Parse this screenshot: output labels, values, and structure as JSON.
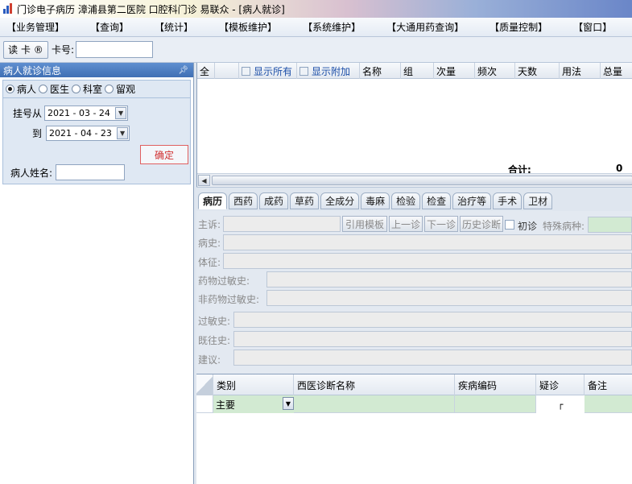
{
  "window": {
    "title": "门诊电子病历  漳浦县第二医院  口腔科门诊  易联众 - [病人就诊]",
    "icon": "app-bars-icon"
  },
  "menu": {
    "items": [
      "【业务管理】",
      "【查询】",
      "【统计】",
      "【模板维护】",
      "【系统维护】",
      "【大通用药查询】",
      "【质量控制】",
      "【窗口】"
    ]
  },
  "toolbar": {
    "read_card_label": "读 卡 ®",
    "card_no_label": "卡号:",
    "card_no_value": ""
  },
  "left_panel": {
    "title": "病人就诊信息",
    "pin_icon": "pin-icon",
    "radios": [
      {
        "label": "病人",
        "checked": true
      },
      {
        "label": "医生",
        "checked": false
      },
      {
        "label": "科室",
        "checked": false
      },
      {
        "label": "留观",
        "checked": false
      }
    ],
    "from_label": "挂号从",
    "from_date": "2021 - 03 - 24",
    "to_label": "到",
    "to_date": "2021 - 04 - 23",
    "confirm_label": "确定",
    "patient_name_label": "病人姓名:",
    "patient_name_value": ""
  },
  "rx_grid": {
    "columns": [
      "全",
      "",
      "显示所有",
      "显示附加",
      "名称",
      "组",
      "次量",
      "频次",
      "天数",
      "用法",
      "总量"
    ],
    "total_label": "合计:",
    "total_value": "0"
  },
  "tabs": [
    "病历",
    "西药",
    "成药",
    "草药",
    "全成分",
    "毒麻",
    "检验",
    "检查",
    "治疗等",
    "手术",
    "卫材"
  ],
  "active_tab": "病历",
  "record_form": {
    "complaint_label": "主诉:",
    "btn_template": "引用模板",
    "btn_prev": "上一诊",
    "btn_next": "下一诊",
    "btn_history": "历史诊断",
    "first_visit_label": "初诊",
    "special_disease_label": "特殊病种:",
    "history_label": "病史:",
    "signs_label": "体征:",
    "drug_allergy_label": "药物过敏史:",
    "nondrug_allergy_label": "非药物过敏史:",
    "allergy_label": "过敏史:",
    "past_history_label": "既往史:",
    "advice_label": "建议:"
  },
  "diag_grid": {
    "columns": [
      "类别",
      "西医诊断名称",
      "疾病编码",
      "疑诊",
      "备注"
    ],
    "rows": [
      {
        "category": "主要",
        "name": "",
        "code": "",
        "suspect": "┌",
        "note": ""
      }
    ]
  }
}
